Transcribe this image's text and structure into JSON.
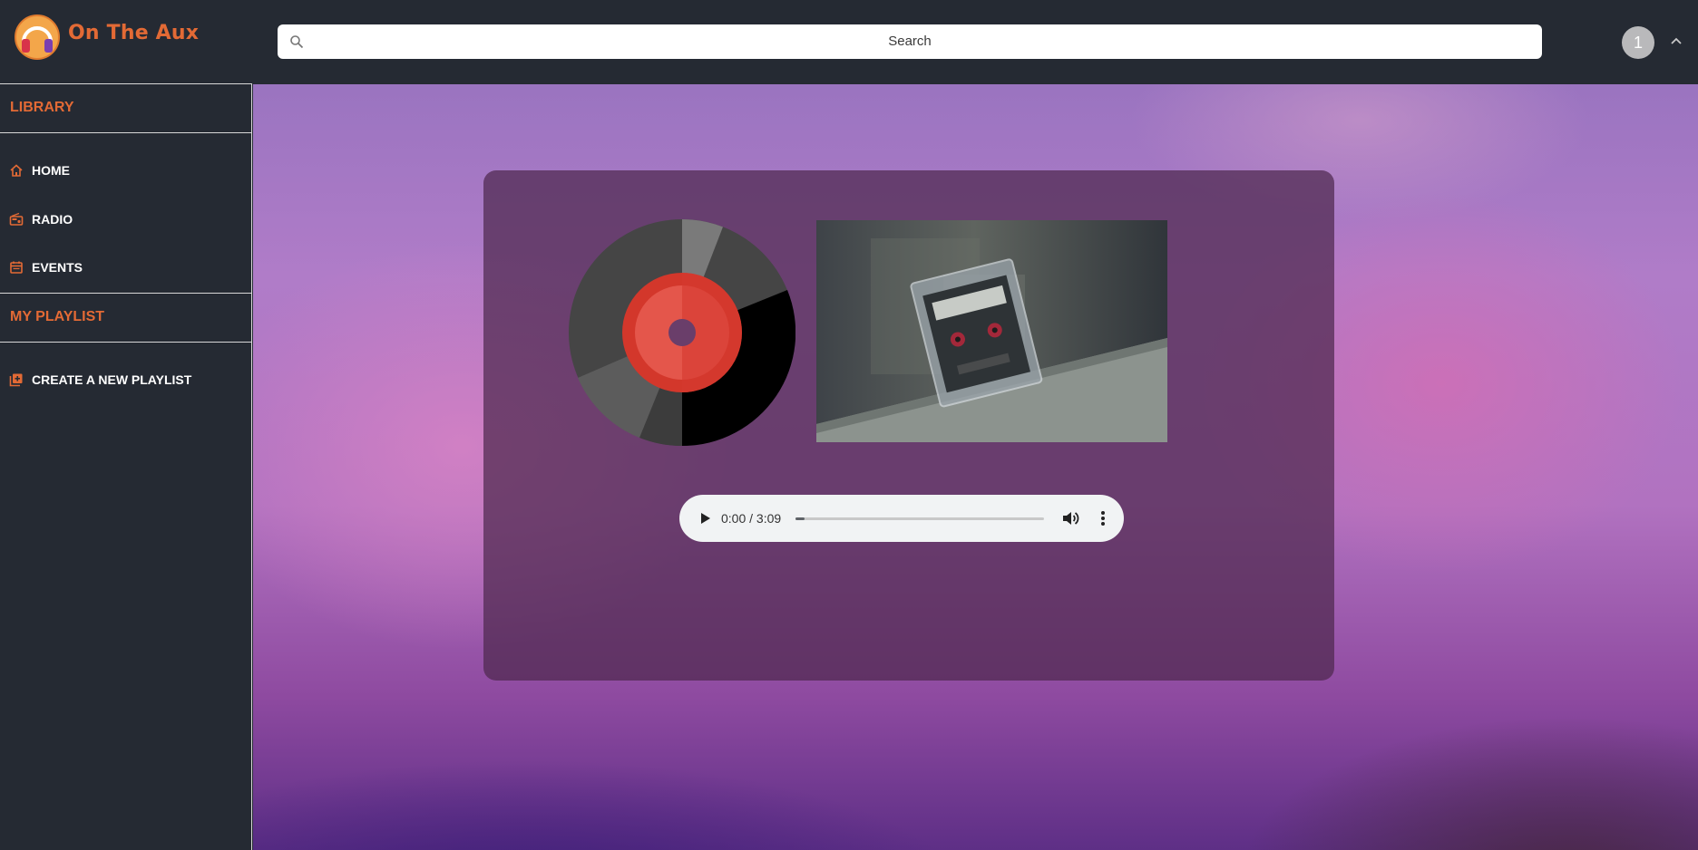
{
  "app": {
    "brand": "On The Aux",
    "accent_color": "#e36a35",
    "logo_icon": "headphones-logo-icon"
  },
  "header": {
    "search": {
      "placeholder": "Search",
      "icon": "search-icon"
    },
    "avatar_initial": "1",
    "menu_icon": "chevron-up-icon"
  },
  "sidebar": {
    "library_heading": "LIBRARY",
    "items": [
      {
        "label": "HOME",
        "icon": "home-icon"
      },
      {
        "label": "RADIO",
        "icon": "radio-icon"
      },
      {
        "label": "EVENTS",
        "icon": "calendar-icon"
      }
    ],
    "playlist_heading": "MY PLAYLIST",
    "playlist_items": [
      {
        "label": "CREATE A NEW PLAYLIST",
        "icon": "add-playlist-icon"
      }
    ]
  },
  "player": {
    "current_time": "0:00",
    "duration": "3:09",
    "time_display": "0:00 / 3:09",
    "progress": 0,
    "play_icon": "play-icon",
    "volume_icon": "volume-icon",
    "more_icon": "more-vertical-icon"
  },
  "artwork": {
    "vinyl_icon": "vinyl-record-icon",
    "cover_image": "cassette-tape-photo"
  }
}
